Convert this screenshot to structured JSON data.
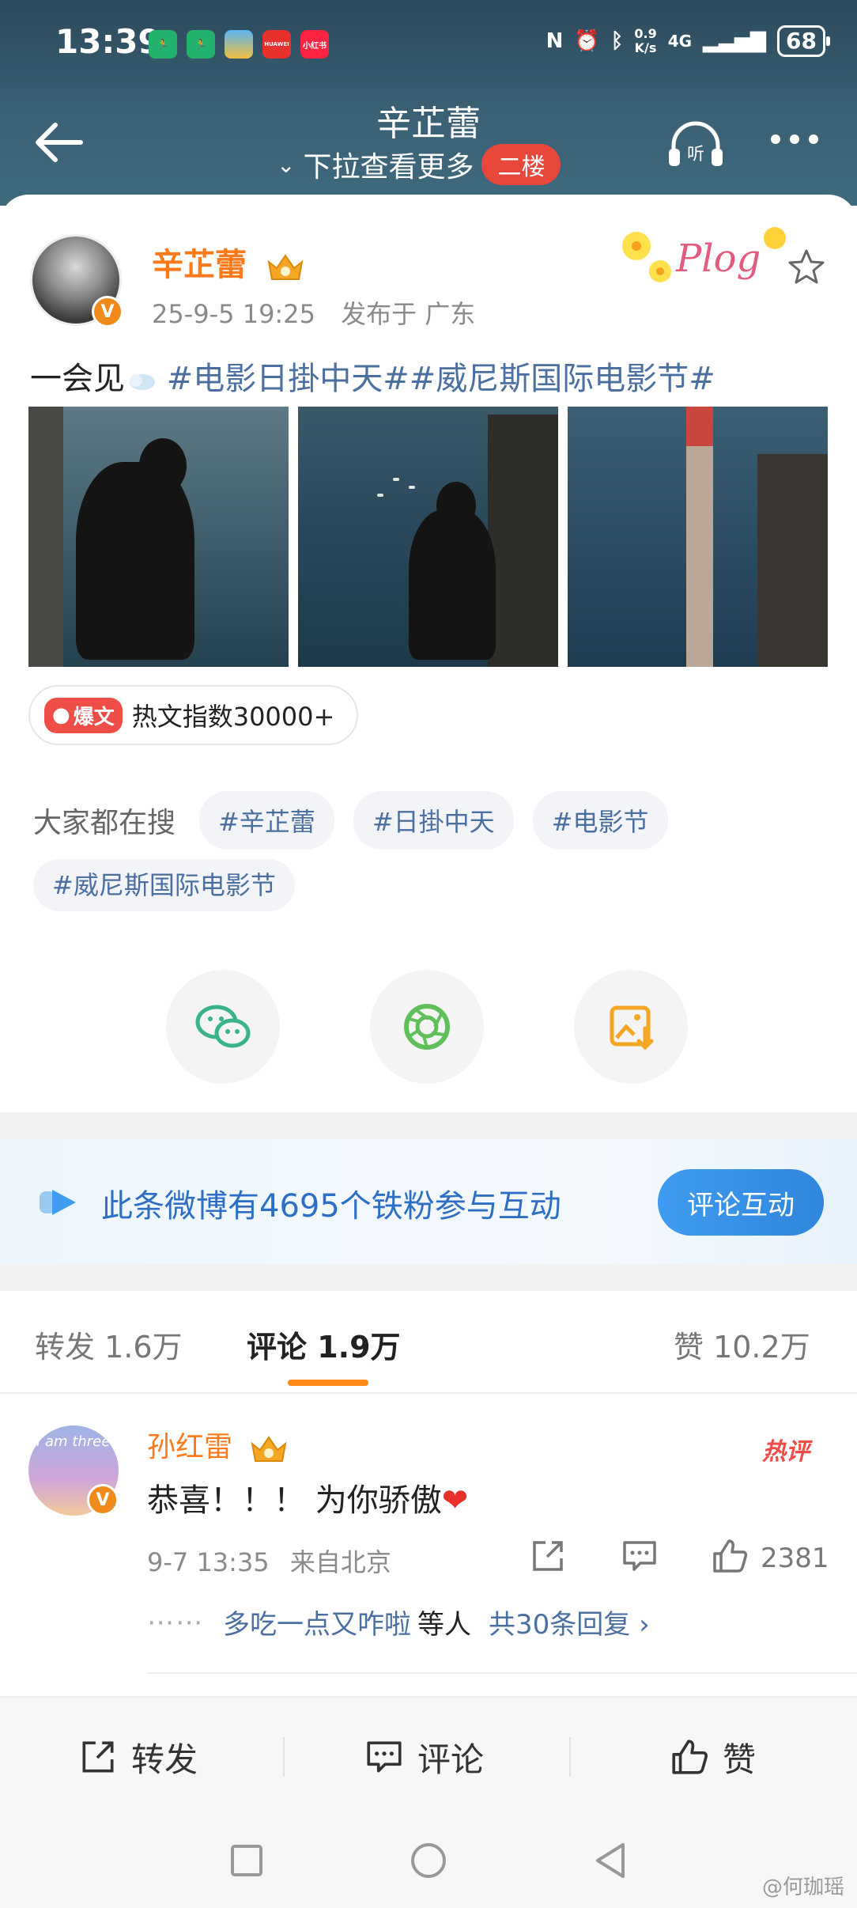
{
  "status_bar": {
    "time": "13:39",
    "net_speed_value": "0.9",
    "net_speed_unit": "K/s",
    "signal": "4G",
    "battery": "68",
    "app_icons": [
      "green-run-app-icon",
      "green-run-app-icon",
      "photo-app-icon",
      "huawei-app-icon",
      "xiaohongshu-app-icon"
    ],
    "app_labels": [
      "",
      "",
      "",
      "HUAWEI",
      "小红书"
    ]
  },
  "header": {
    "title": "辛芷蕾",
    "subtitle": "下拉查看更多",
    "floor_badge": "二楼",
    "colors": {
      "bg": "#3a6074",
      "badge": "#e8473c"
    }
  },
  "post": {
    "author": "辛芷蕾",
    "avatar_badge": "V",
    "date": "25-9-5 19:25",
    "location": "发布于 广东",
    "text_prefix": "一会见",
    "text_tags": "#电影日掛中天##威尼斯国际电影节#",
    "sticker_text": "Plog",
    "hot_badge_label": "爆文",
    "hot_index": "热文指数30000+",
    "search_label": "大家都在搜",
    "search_chips": [
      "#辛芷蕾",
      "#日掛中天",
      "#电影节",
      "#威尼斯国际电影节"
    ],
    "share_targets": [
      "wechat-icon",
      "moments-icon",
      "save-image-icon"
    ]
  },
  "fans_banner": {
    "text": "此条微博有4695个铁粉参与互动",
    "button": "评论互动"
  },
  "tabs": {
    "repost": "转发 1.6万",
    "comments": "评论 1.9万",
    "likes": "赞 10.2万",
    "active": "comments",
    "accent": "#ff8a1a"
  },
  "comment": {
    "author": "孙红雷",
    "avatar_text": "I am three",
    "avatar_badge": "V",
    "hot_label": "热评",
    "text": "恭喜！！！ 为你骄傲",
    "emoji": "❤",
    "time": "9-7 13:35",
    "location": "来自北京",
    "likes": "2381",
    "reply_dots": "⋯⋯",
    "reply_user": "多吃一点又咋啦",
    "reply_suffix": "等人",
    "reply_count": "共30条回复 ›"
  },
  "bottom_bar": {
    "repost": "转发",
    "comment": "评论",
    "like": "赞"
  },
  "watermark": "@何珈瑶"
}
